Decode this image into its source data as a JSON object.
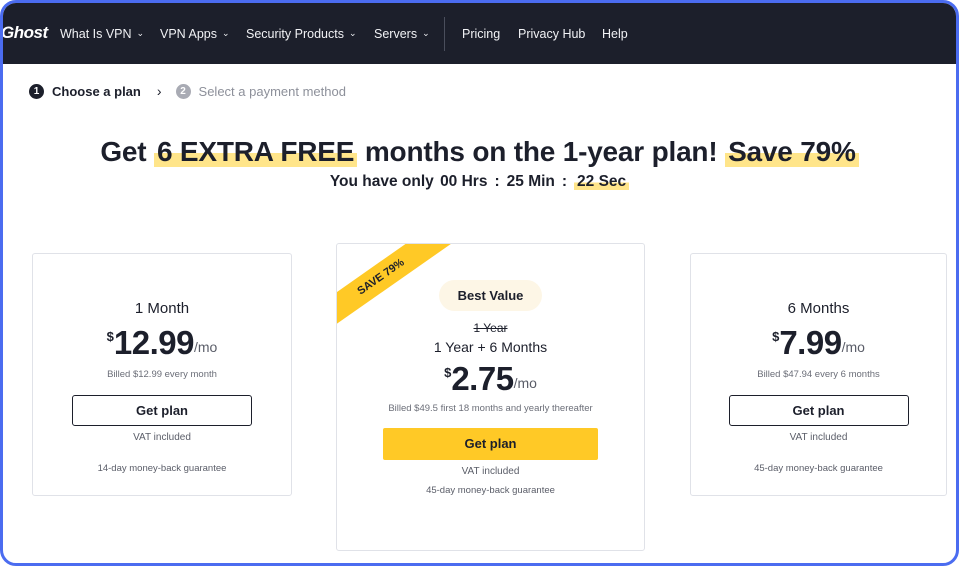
{
  "nav": {
    "logo": "Ghost",
    "items": [
      {
        "label": "What Is VPN",
        "has_dropdown": true
      },
      {
        "label": "VPN Apps",
        "has_dropdown": true
      },
      {
        "label": "Security Products",
        "has_dropdown": true
      },
      {
        "label": "Servers",
        "has_dropdown": true
      },
      {
        "label": "Pricing",
        "has_dropdown": false
      },
      {
        "label": "Privacy Hub",
        "has_dropdown": false
      },
      {
        "label": "Help",
        "has_dropdown": false
      }
    ]
  },
  "steps": [
    {
      "number": "1",
      "label": "Choose a plan",
      "active": true
    },
    {
      "number": "2",
      "label": "Select a payment method",
      "active": false
    }
  ],
  "steps_separator": "›",
  "headline": {
    "pre": "Get",
    "highlight1": "6 EXTRA FREE",
    "mid": "months on the 1-year plan!",
    "highlight2": "Save 79%"
  },
  "timer": {
    "prefix": "You have only",
    "hours": "00 Hrs",
    "minutes": "25 Min",
    "seconds": "22 Sec"
  },
  "plans": {
    "left": {
      "name": "1 Month",
      "currency": "$",
      "price": "12.99",
      "period": "/mo",
      "billed": "Billed $12.99 every month",
      "button": "Get plan",
      "vat": "VAT included",
      "guarantee": "14-day money-back guarantee"
    },
    "middle": {
      "ribbon": "SAVE 79%",
      "badge": "Best Value",
      "old_term": "1 Year",
      "name": "1 Year + 6 Months",
      "currency": "$",
      "price": "2.75",
      "period": "/mo",
      "billed": "Billed $49.5 first 18 months and yearly thereafter",
      "button": "Get plan",
      "vat": "VAT included",
      "guarantee": "45-day money-back guarantee"
    },
    "right": {
      "name": "6 Months",
      "currency": "$",
      "price": "7.99",
      "period": "/mo",
      "billed": "Billed $47.94 every 6 months",
      "button": "Get plan",
      "vat": "VAT included",
      "guarantee": "45-day money-back guarantee"
    }
  },
  "colors": {
    "nav_bg": "#1c1f2b",
    "accent_yellow": "#ffc926",
    "highlight": "#ffe58a",
    "frame_border": "#4b6cf0"
  }
}
